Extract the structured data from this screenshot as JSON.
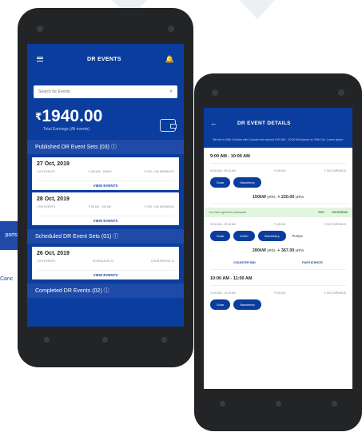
{
  "colors": {
    "brand_blue": "#0a3d9e",
    "section_blue": "#1f4aa8",
    "green_banner": "#e3f4e0"
  },
  "left_fragment": {
    "bar_text": "ports",
    "link_text": "Canc"
  },
  "screen1": {
    "app_title": "DR EVENTS",
    "search_placeholder": "Search for Events",
    "amount_currency": "₹",
    "amount_value": "1940.00",
    "earnings_label": "Total Earnings (All events)",
    "published_header": "Published DR Event Sets (03) ⓘ",
    "published_cards": [
      {
        "date": "27 Oct, 2019",
        "meta": [
          "2 DR EVENTS",
          "₹ 180 kW - 150kW",
          "₹ 200 - 150 EARNINGS"
        ],
        "view": "VIEW EVENTS"
      },
      {
        "date": "28 Oct, 2019",
        "meta": [
          "1 DR EVENTS",
          "₹ 80 kW - 150 kW",
          "₹ 200 - 150 EARNINGS"
        ],
        "view": "VIEW EVENTS"
      }
    ],
    "scheduled_header": "Scheduled DR Event Sets (01) ⓘ",
    "scheduled_cards": [
      {
        "date": "26 Oct, 2019",
        "meta": [
          "2 DR EVENTS",
          "SCHEDULED 12",
          "COUNTER BID 12"
        ],
        "view": "VIEW EVENTS"
      }
    ],
    "completed_header": "Completed DR Events (02) ⓘ"
  },
  "screen2": {
    "title": "DR EVENT DETAILS",
    "back_icon": "←",
    "info_text": "Bid set in 26th October with Counter bid request 9:00 AM - 10:00 AM placed on 25th Oct. Lorem ipsum",
    "slots": [
      {
        "time": "9:00 AM - 10:00 AM",
        "meta": [
          "09:00 AM - 09:15 AM",
          "₹ 400 kW",
          "₹ 220 EARNINGS"
        ],
        "chips": [
          "Solar",
          "Machinery"
        ],
        "chip_label": "",
        "kwh": "150kW",
        "kwh_unit": "yRhs",
        "price": "+ 220.00",
        "price_unit": "yRhs",
        "green_text": "You have agreed to participate",
        "green_edit": "EDIT",
        "green_withdraw": "WITHDRAW"
      },
      {
        "time": "",
        "meta": [
          "09:00 AM - 09:45 AM",
          "₹ 400 kW",
          "₹ 220 EARNINGS"
        ],
        "chips": [
          "Solar",
          "HVAC",
          "Machinery"
        ],
        "chip_label": "Pumps",
        "kwh": "280kW",
        "kwh_unit": "yRhs",
        "price": "+ 367.00",
        "price_unit": "yRhs",
        "action_left": "COUNTER BID",
        "action_right": "PARTICIPATE"
      },
      {
        "time": "10:00 AM - 11:00 AM",
        "meta": [
          "10:00 AM - 10:45 AM",
          "₹ 400 kW",
          "₹ 220 EARNINGS"
        ],
        "chips": [
          "Solar",
          "Machinery"
        ]
      }
    ]
  }
}
